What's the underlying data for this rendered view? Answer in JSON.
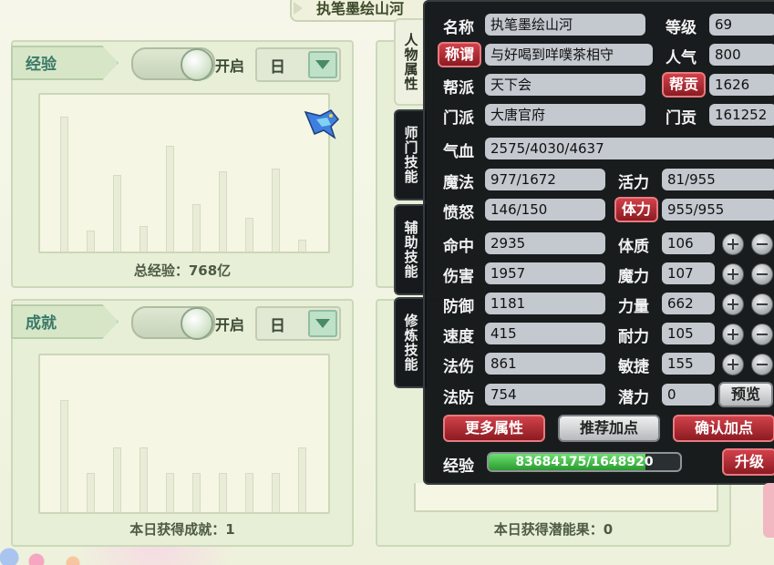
{
  "top_title": "执笔墨绘山河",
  "left_panels": [
    {
      "header": "经验",
      "toggle_label": "开启",
      "select_value": "日",
      "footer": "总经验：768亿",
      "bars": [
        0.94,
        0.14,
        0.53,
        0.17,
        0.74,
        0.33,
        0.56,
        0.23,
        0.58,
        0.08
      ]
    },
    {
      "header": "成就",
      "toggle_label": "开启",
      "select_value": "日",
      "footer": "本日获得成就：1",
      "bars": [
        0.78,
        0.27,
        0.45,
        0.45,
        0.27,
        0.27,
        0.27,
        0.27,
        0.27,
        0.45
      ]
    }
  ],
  "middle_footer": "本日获得潜能果：0",
  "side_tabs": [
    "人物属性",
    "师门技能",
    "辅助技能",
    "修炼技能"
  ],
  "attrs": {
    "name_label": "名称",
    "name": "执笔墨绘山河",
    "level_label": "等级",
    "level": "69",
    "title_btn": "称谓",
    "title": "与好喝到咩噗茶相守",
    "popularity_label": "人气",
    "popularity": "800",
    "gang_label": "帮派",
    "gang": "天下会",
    "contrib_btn": "帮贡",
    "contrib": "1626",
    "school_label": "门派",
    "school": "大唐官府",
    "school_contrib_label": "门贡",
    "school_contrib": "161252",
    "hp_label": "气血",
    "hp": "2575/4030/4637",
    "mp_label": "魔法",
    "mp": "977/1672",
    "vitality_label": "活力",
    "vitality": "81/955",
    "anger_label": "愤怒",
    "anger": "146/150",
    "stamina_btn": "体力",
    "stamina": "955/955",
    "hit_label": "命中",
    "hit": "2935",
    "damage_label": "伤害",
    "damage": "1957",
    "defense_label": "防御",
    "defense": "1181",
    "speed_label": "速度",
    "speed": "415",
    "magic_dmg_label": "法伤",
    "magic_dmg": "861",
    "magic_def_label": "法防",
    "magic_def": "754",
    "con_label": "体质",
    "con": "106",
    "mag_label": "魔力",
    "mag": "107",
    "str_label": "力量",
    "str": "662",
    "end_label": "耐力",
    "end": "105",
    "agi_label": "敏捷",
    "agi": "155",
    "potential_label": "潜力",
    "potential": "0",
    "preview_btn": "预览",
    "more_btn": "更多属性",
    "recommend_btn": "推荐加点",
    "confirm_btn": "确认加点",
    "exp_label": "经验",
    "exp": "83684175/1648920",
    "exp_fill": 0.82,
    "upgrade_btn": "升级"
  }
}
